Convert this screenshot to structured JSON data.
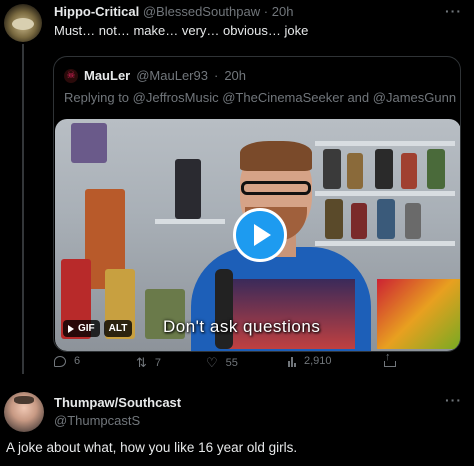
{
  "tweet": {
    "author_name": "Hippo-Critical",
    "author_handle": "@BlessedSouthpaw",
    "separator": "·",
    "time": "20h",
    "text": "Must… not… make… very… obvious… joke",
    "more_label": "···"
  },
  "quoted": {
    "author_name": "MauLer",
    "author_handle": "@MauLer93",
    "separator": "·",
    "time": "20h",
    "reply_prefix": "Replying to",
    "reply_to": [
      "@JeffrosMusic",
      "@TheCinemaSeeker",
      "@JamesGunn"
    ],
    "reply_joiner": "and",
    "video": {
      "caption": "Don't ask questions",
      "gif_label": "GIF",
      "alt_label": "ALT"
    }
  },
  "actions": {
    "replies": "6",
    "retweets": "7",
    "likes": "55",
    "views": "2,910"
  },
  "reply": {
    "author_name": "Thumpaw/Southcast",
    "author_handle": "@ThumpcastS",
    "more_label": "···",
    "text": "A joke about what, how you like 16 year old girls."
  },
  "colors": {
    "background": "#000000",
    "text": "#e7e9ea",
    "muted": "#71767b",
    "accent": "#1d9bf0",
    "border": "#2f3336"
  },
  "icons": [
    "reply-icon",
    "retweet-icon",
    "like-icon",
    "views-icon",
    "share-icon",
    "play-icon",
    "more-icon"
  ]
}
